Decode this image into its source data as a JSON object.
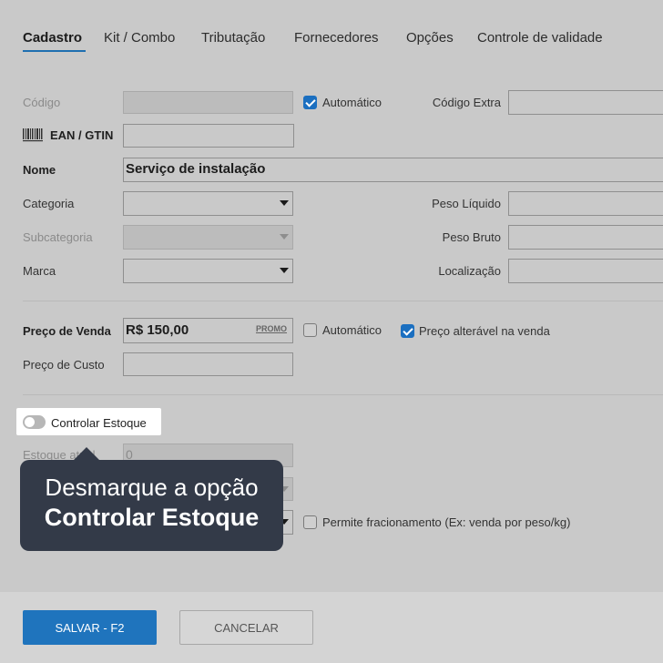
{
  "tabs": [
    "Cadastro",
    "Kit / Combo",
    "Tributação",
    "Fornecedores",
    "Opções",
    "Controle de validade"
  ],
  "form": {
    "codigo_label": "Código",
    "codigo_value": "",
    "automatico_label": "Automático",
    "codigo_extra_label": "Código Extra",
    "ean_label": "EAN / GTIN",
    "ean_value": "",
    "nome_label": "Nome",
    "nome_value": "Serviço de instalação",
    "categoria_label": "Categoria",
    "subcategoria_label": "Subcategoria",
    "marca_label": "Marca",
    "peso_liquido_label": "Peso Líquido",
    "peso_bruto_label": "Peso Bruto",
    "localizacao_label": "Localização",
    "preco_venda_label": "Preço de Venda",
    "preco_venda_value": "R$ 150,00",
    "promo_label": "PROMO",
    "preco_automatico_label": "Automático",
    "preco_alteravel_label": "Preço alterável na venda",
    "preco_custo_label": "Preço de Custo",
    "controlar_estoque_label": "Controlar Estoque",
    "estoque_label": "Estoque atual",
    "estoque_value": "0",
    "fracionamento_label": "Permite fracionamento (Ex: venda por peso/kg)"
  },
  "checkbox_states": {
    "codigo_automatico": true,
    "preco_automatico": false,
    "preco_alteravel": true,
    "fracionamento": false,
    "controlar_estoque": false
  },
  "tooltip": {
    "line1": "Desmarque a opção",
    "line2": "Controlar Estoque"
  },
  "buttons": {
    "save": "SALVAR - F2",
    "cancel": "CANCELAR"
  },
  "colors": {
    "accent": "#1f74bd",
    "tooltip_bg": "#333a48"
  }
}
